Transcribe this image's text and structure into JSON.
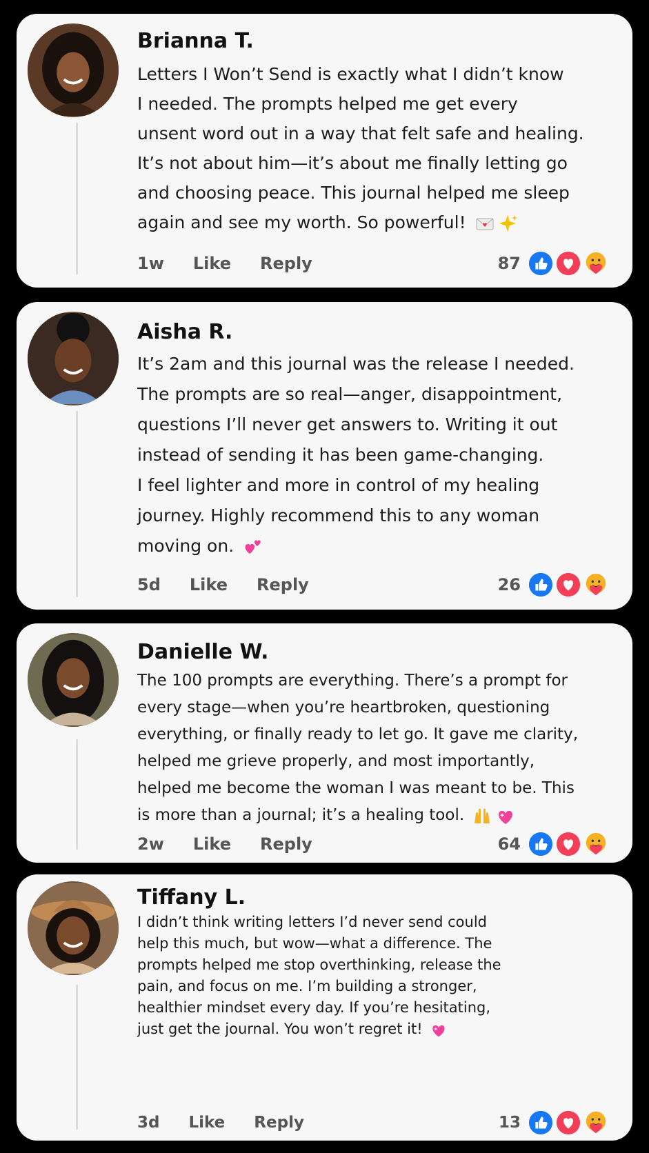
{
  "comments": [
    {
      "name": "Brianna T.",
      "lines": [
        "Letters I Won’t Send is exactly what I didn’t know",
        "I needed. The prompts helped me get every",
        "unsent word out in a way that felt safe and healing.",
        "It’s not about him—it’s about me finally letting go",
        "and choosing peace. This journal helped me sleep",
        "again and see my worth. So powerful!"
      ],
      "emojis": [
        "love-letter-emoji",
        "sparkles-emoji"
      ],
      "time": "1w",
      "like": "Like",
      "reply": "Reply",
      "count": "87"
    },
    {
      "name": "Aisha R.",
      "lines": [
        "It’s 2am and this journal was the release I needed.",
        "The prompts are so real—anger, disappointment,",
        "questions I’ll never get answers to. Writing it out",
        "instead of sending it has been game-changing.",
        "I feel lighter and more in control of my healing",
        "journey. Highly recommend this to any woman",
        "moving on."
      ],
      "emojis": [
        "two-hearts-emoji"
      ],
      "time": "5d",
      "like": "Like",
      "reply": "Reply",
      "count": "26"
    },
    {
      "name": "Danielle W.",
      "lines": [
        "The 100 prompts are everything. There’s a prompt for",
        "every stage—when you’re heartbroken, questioning",
        "everything, or finally ready to let go. It gave me clarity,",
        "helped me grieve properly, and most importantly,",
        "helped me become the woman I was meant to be. This",
        "is more than a journal; it’s a healing tool."
      ],
      "emojis": [
        "raising-hands-emoji",
        "sparkling-heart-emoji"
      ],
      "time": "2w",
      "like": "Like",
      "reply": "Reply",
      "count": "64"
    },
    {
      "name": "Tiffany L.",
      "lines": [
        "I didn’t think writing letters I’d never send could",
        "help this much, but wow—what a difference. The",
        "prompts helped me stop overthinking, release the",
        "pain, and focus on me. I’m building a stronger,",
        "healthier mindset every day. If you’re hesitating,",
        "just get the journal. You won’t regret it!"
      ],
      "emojis": [
        "sparkling-heart-emoji"
      ],
      "time": "3d",
      "like": "Like",
      "reply": "Reply",
      "count": "13"
    }
  ],
  "reaction_icons": [
    "like-reaction-icon",
    "love-reaction-icon",
    "care-reaction-icon"
  ],
  "colors": {
    "like_blue": "#1877f2",
    "love_red": "#f33e58",
    "care_yellow": "#f7b125",
    "card_bg": "#f7f7f7",
    "page_bg": "#000000"
  }
}
